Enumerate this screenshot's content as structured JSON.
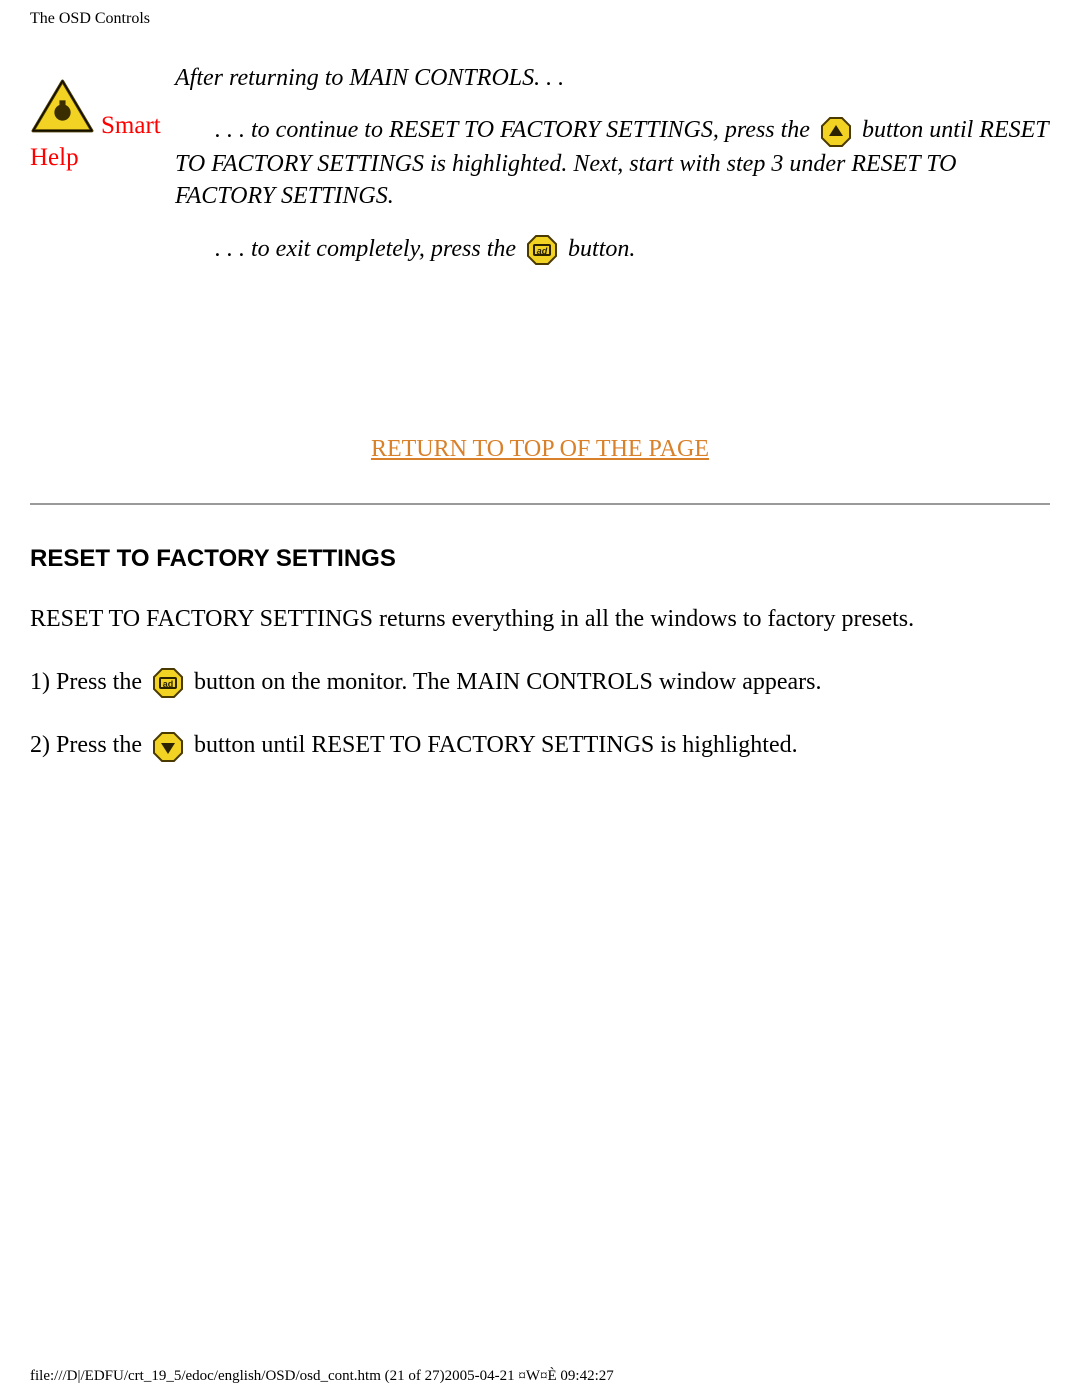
{
  "header": {
    "title": "The OSD Controls"
  },
  "smart_help": {
    "line1": "Smart",
    "line2": "Help"
  },
  "top_section": {
    "intro": "After returning to MAIN CONTROLS. . .",
    "para_continue_pre": ". . . to continue to RESET TO FACTORY SETTINGS, press the ",
    "para_continue_post": " button until RESET TO FACTORY SETTINGS is highlighted. Next, start with step 3 under RESET TO FACTORY SETTINGS.",
    "para_exit_pre": ". . . to exit completely, press the",
    "para_exit_post": " button."
  },
  "return_link": "RETURN TO TOP OF THE PAGE",
  "section": {
    "heading": "RESET TO FACTORY SETTINGS",
    "desc": "RESET TO FACTORY SETTINGS returns everything in all the windows to factory presets.",
    "step1_pre": "1) Press the ",
    "step1_post": " button on the monitor. The MAIN CONTROLS window appears.",
    "step2_pre": "2) Press the ",
    "step2_post": "button until RESET TO FACTORY SETTINGS is highlighted."
  },
  "footer": "file:///D|/EDFU/crt_19_5/edoc/english/OSD/osd_cont.htm (21 of 27)2005-04-21 ¤W¤È 09:42:27",
  "icons": {
    "warning": "warning-triangle-icon",
    "up": "up-arrow-button-icon",
    "down": "down-arrow-button-icon",
    "ok": "ok-button-icon"
  },
  "colors": {
    "accent_orange": "#d9812a",
    "red": "#ff0000",
    "icon_yellow": "#f2d323",
    "icon_stroke": "#4a3a00"
  }
}
